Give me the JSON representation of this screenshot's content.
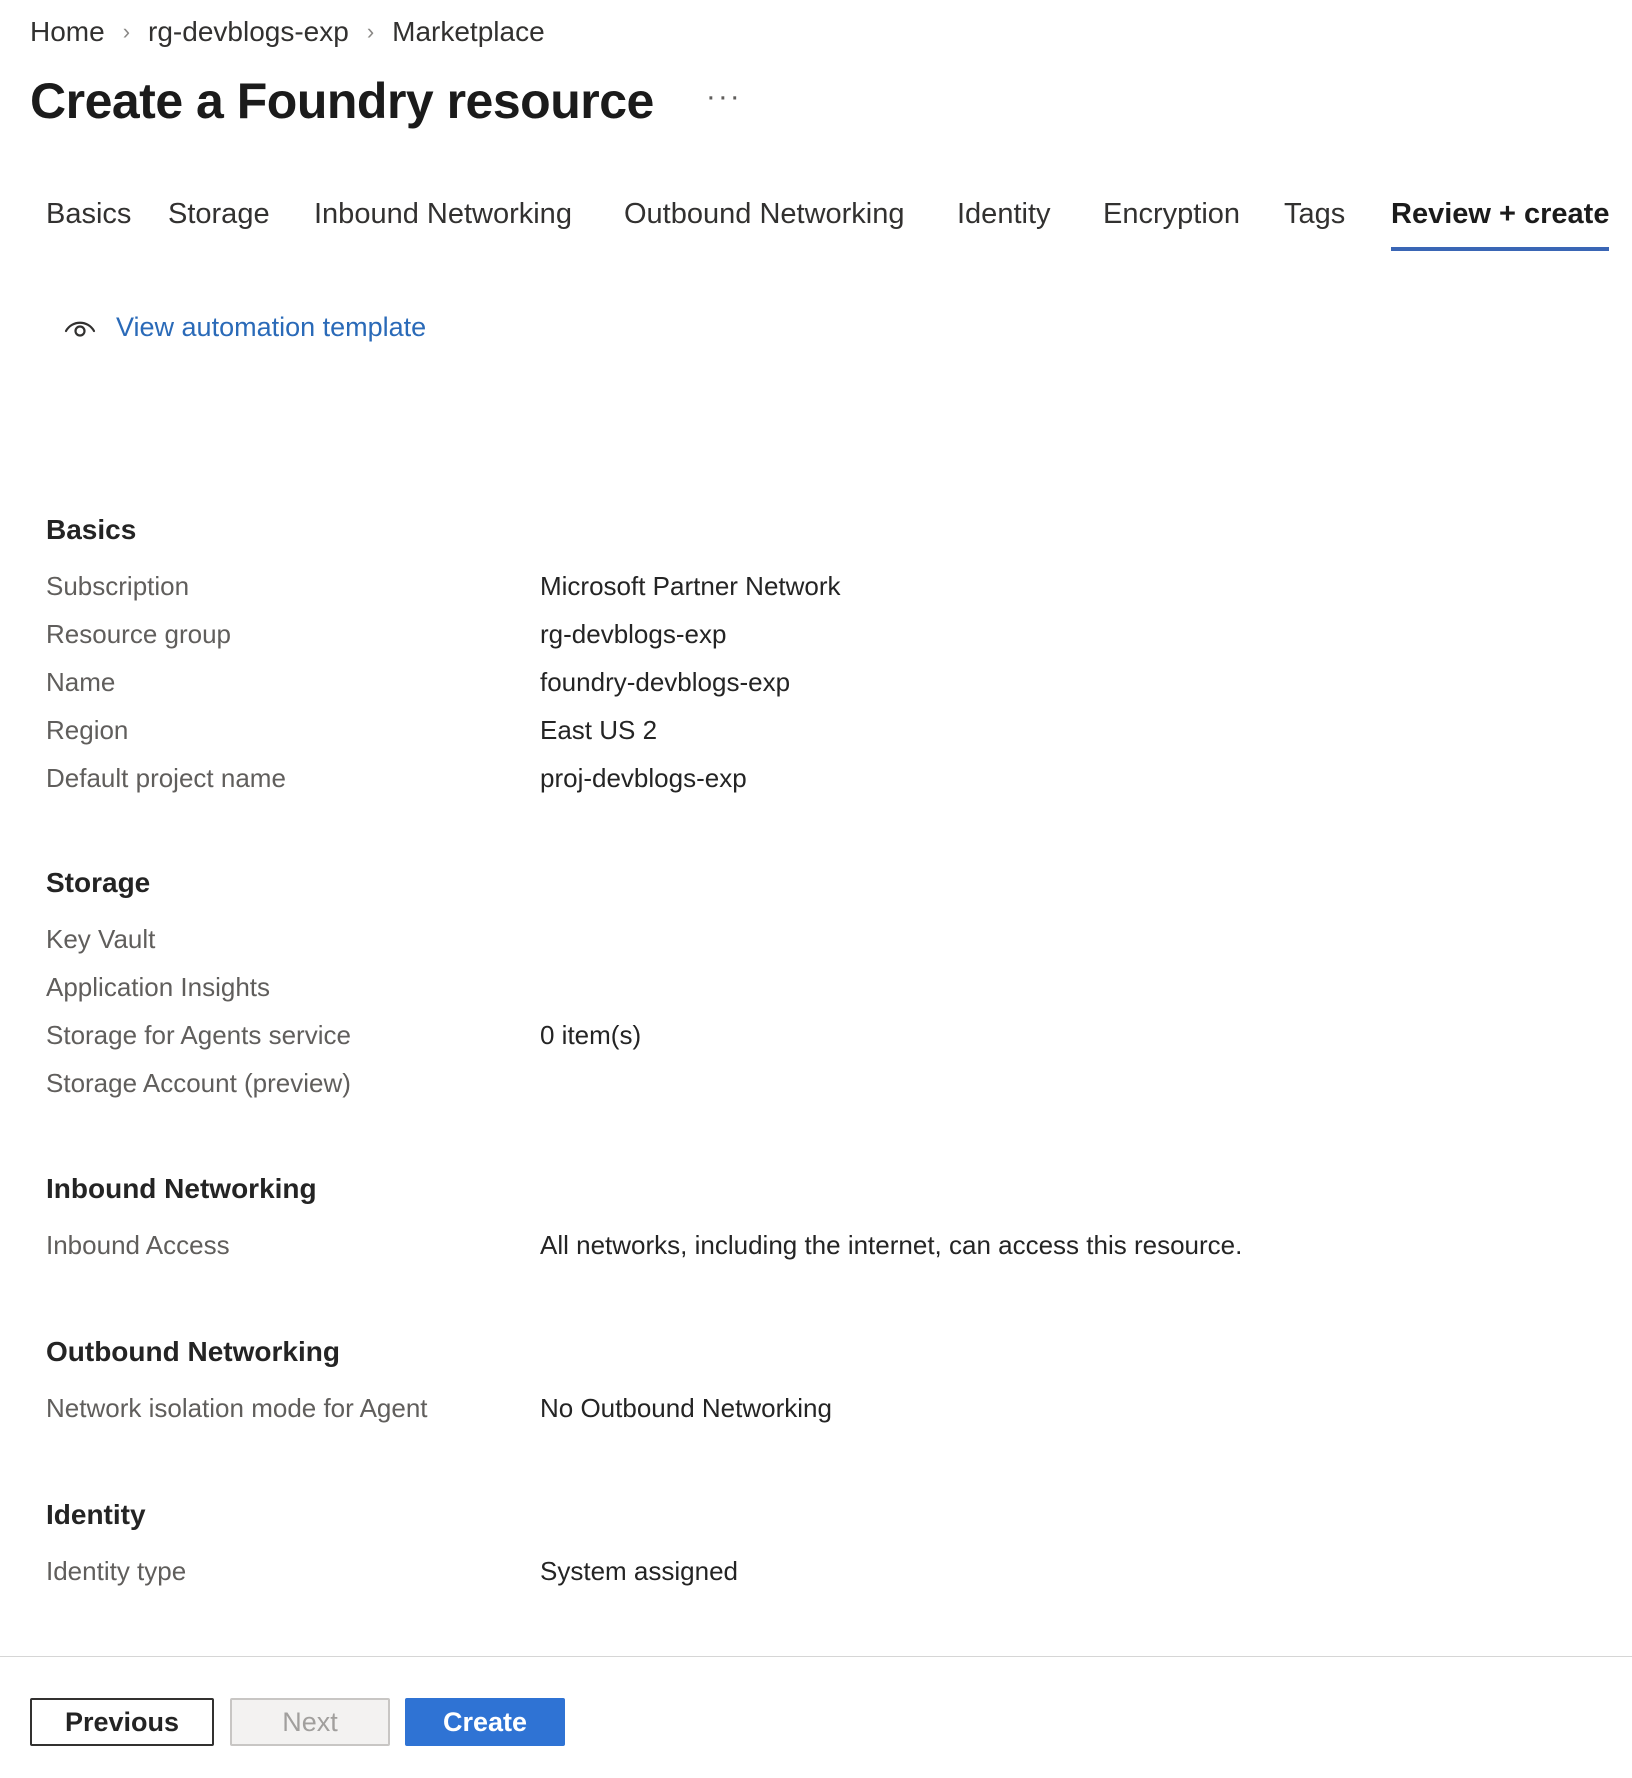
{
  "breadcrumb": {
    "items": [
      "Home",
      "rg-devblogs-exp",
      "Marketplace"
    ],
    "separator": "›"
  },
  "page": {
    "title": "Create a Foundry resource",
    "more": "···"
  },
  "tabs": [
    {
      "label": "Basics"
    },
    {
      "label": "Storage"
    },
    {
      "label": "Inbound Networking"
    },
    {
      "label": "Outbound Networking"
    },
    {
      "label": "Identity"
    },
    {
      "label": "Encryption"
    },
    {
      "label": "Tags"
    },
    {
      "label": "Review + create",
      "active": true
    }
  ],
  "template_link": {
    "label": "View automation template",
    "icon": "eye-icon"
  },
  "sections": {
    "basics": {
      "title": "Basics",
      "rows": [
        {
          "label": "Subscription",
          "value": "Microsoft Partner Network"
        },
        {
          "label": "Resource group",
          "value": "rg-devblogs-exp"
        },
        {
          "label": "Name",
          "value": "foundry-devblogs-exp"
        },
        {
          "label": "Region",
          "value": "East US 2"
        },
        {
          "label": "Default project name",
          "value": "proj-devblogs-exp"
        }
      ]
    },
    "storage": {
      "title": "Storage",
      "rows": [
        {
          "label": "Key Vault",
          "value": ""
        },
        {
          "label": "Application Insights",
          "value": ""
        },
        {
          "label": "Storage for Agents service",
          "value": "0 item(s)"
        },
        {
          "label": "Storage Account (preview)",
          "value": ""
        }
      ]
    },
    "inbound": {
      "title": "Inbound Networking",
      "rows": [
        {
          "label": "Inbound Access",
          "value": "All networks, including the internet, can access this resource."
        }
      ]
    },
    "outbound": {
      "title": "Outbound Networking",
      "rows": [
        {
          "label": "Network isolation mode for Agent",
          "value": "No Outbound Networking"
        }
      ]
    },
    "identity": {
      "title": "Identity",
      "rows": [
        {
          "label": "Identity type",
          "value": "System assigned"
        }
      ]
    }
  },
  "footer": {
    "previous_label": "Previous",
    "next_label": "Next",
    "create_label": "Create"
  },
  "colors": {
    "accent": "#3a66b5",
    "link": "#2a6ab8",
    "primary_button": "#2f73d4",
    "label_text": "#605e5c"
  }
}
